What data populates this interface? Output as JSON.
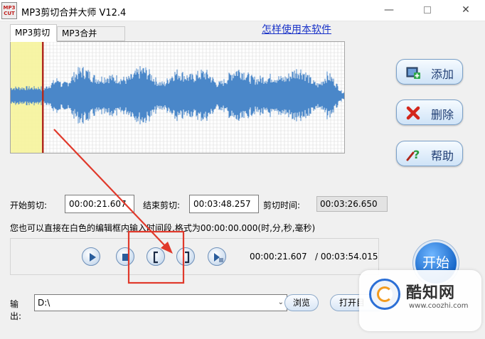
{
  "window": {
    "logo_top": "MP3",
    "logo_bottom": "CUT",
    "title": "MP3剪切合并大师 V12.4",
    "minimize": "—",
    "close": "✕"
  },
  "tabs": [
    {
      "label": "MP3剪切",
      "active": true
    },
    {
      "label": "MP3合并",
      "active": false
    }
  ],
  "help_link": "怎样使用本软件",
  "waveform": {
    "selection_color": "#f7f3a0",
    "wave_color": "#4a87c9",
    "marker_color": "#b02a1f",
    "grid_color": "#dcdcdc"
  },
  "side_buttons": {
    "add": {
      "label": "添加",
      "icon": "add-file-icon"
    },
    "delete": {
      "label": "删除",
      "icon": "red-x-icon"
    },
    "help": {
      "label": "帮助",
      "icon": "help-question-icon"
    }
  },
  "times": {
    "start_label": "开始剪切:",
    "start_value": "00:00:21.607",
    "end_label": "结束剪切:",
    "end_value": "00:03:48.257",
    "duration_label": "剪切时间:",
    "duration_value": "00:03:26.650"
  },
  "hint": "您也可以直接在白色的编辑框内输入时间段,格式为00:00:00.000(时,分,秒,毫秒)",
  "player": {
    "buttons": [
      "play-icon",
      "stop-icon",
      "set-start-bracket-icon",
      "set-end-bracket-icon",
      "play-selection-icon"
    ],
    "current_time": "00:00:21.607",
    "total_time": "/ 00:03:54.015"
  },
  "start_button": "开始",
  "output": {
    "label": "输出:",
    "path": "D:\\",
    "browse": "浏览",
    "open": "打开目"
  },
  "annotation": {
    "color": "#e0392b"
  },
  "watermark": {
    "name": "酷知网",
    "url": "www.coozhi.com"
  }
}
